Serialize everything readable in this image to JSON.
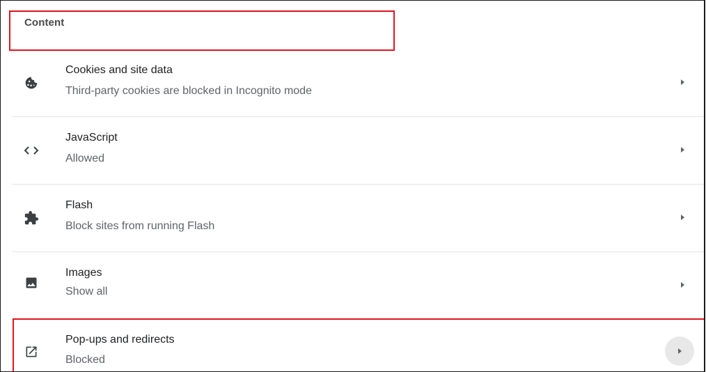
{
  "section": {
    "title": "Content"
  },
  "rows": [
    {
      "title": "Cookies and site data",
      "subtitle": "Third-party cookies are blocked in Incognito mode",
      "icon": "cookie-icon"
    },
    {
      "title": "JavaScript",
      "subtitle": "Allowed",
      "icon": "code-brackets-icon"
    },
    {
      "title": "Flash",
      "subtitle": "Block sites from running Flash",
      "icon": "puzzle-piece-icon"
    },
    {
      "title": "Images",
      "subtitle": "Show all",
      "icon": "image-icon"
    },
    {
      "title": "Pop-ups and redirects",
      "subtitle": "Blocked",
      "icon": "open-in-new-icon"
    }
  ],
  "colors": {
    "highlight": "#e0141e",
    "icon": "#3c4043",
    "divider": "#e4e4e4"
  }
}
